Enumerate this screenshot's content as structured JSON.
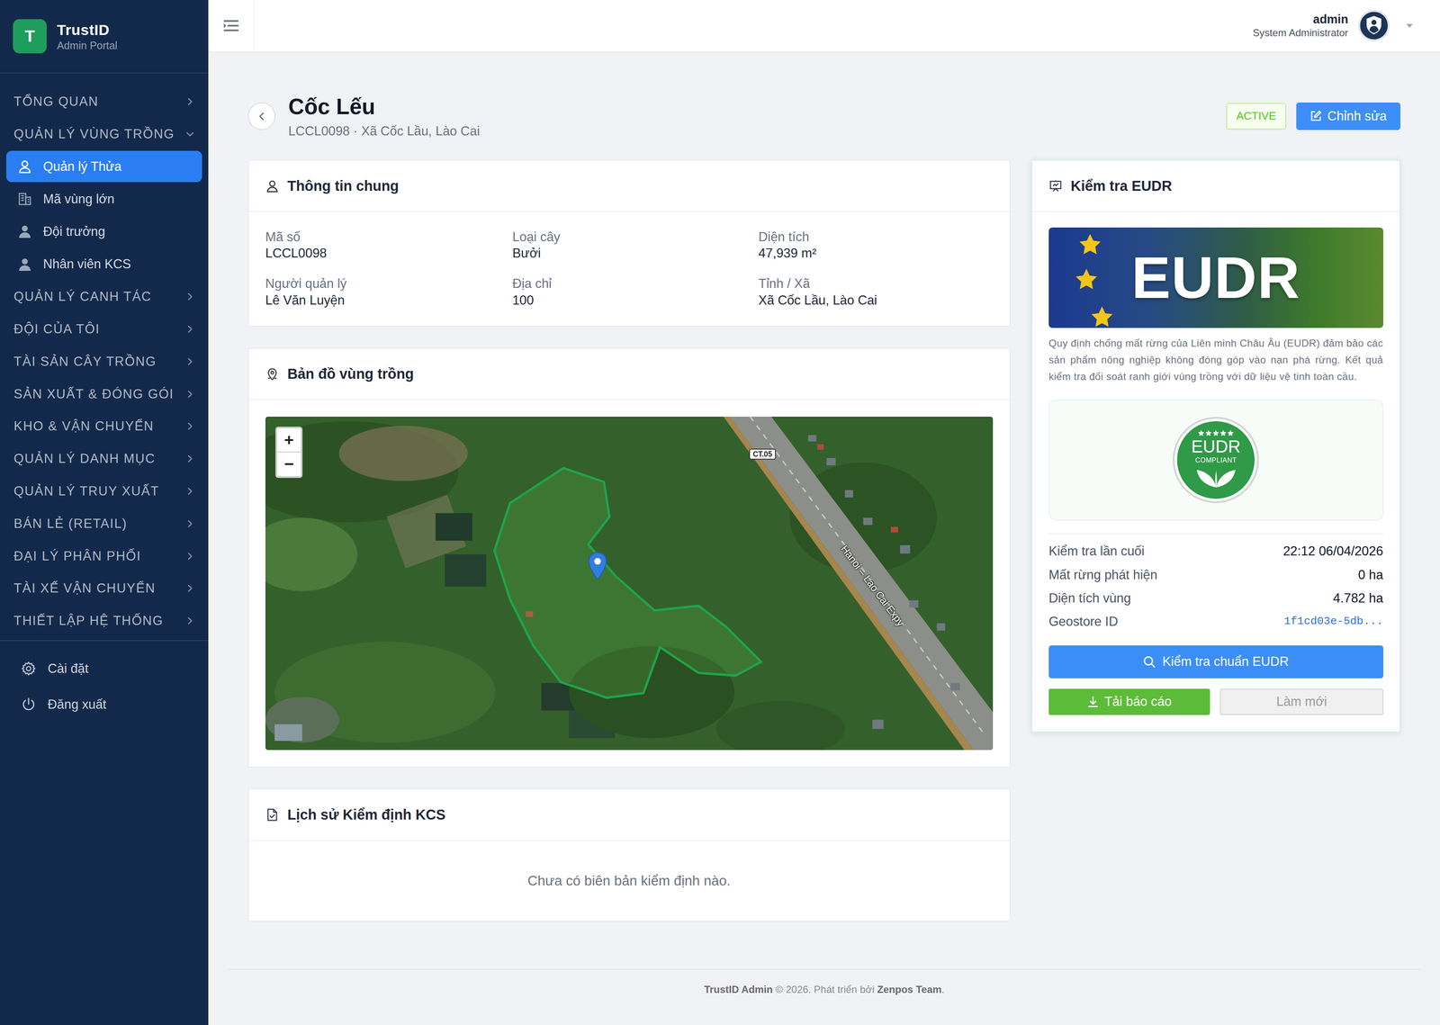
{
  "brand": {
    "logo": "T",
    "name": "TrustID",
    "subtitle": "Admin Portal"
  },
  "sidebar": {
    "items": [
      {
        "label": "TỔNG QUAN",
        "kind": "section",
        "expanded": false,
        "selected": false
      },
      {
        "label": "QUẢN LÝ VÙNG TRỒNG",
        "kind": "section",
        "expanded": true,
        "selected": false
      },
      {
        "label": "Quản lý Thửa",
        "kind": "child",
        "selected": true
      },
      {
        "label": "Mã vùng lớn",
        "kind": "child",
        "selected": false
      },
      {
        "label": "Đội trưởng",
        "kind": "child",
        "selected": false
      },
      {
        "label": "Nhân viên KCS",
        "kind": "child",
        "selected": false
      },
      {
        "label": "QUẢN LÝ CANH TÁC",
        "kind": "section",
        "expanded": false,
        "selected": false
      },
      {
        "label": "ĐỘI CỦA TÔI",
        "kind": "section",
        "expanded": false,
        "selected": false
      },
      {
        "label": "TÀI SẢN CÂY TRỒNG",
        "kind": "section",
        "expanded": false,
        "selected": false
      },
      {
        "label": "SẢN XUẤT & ĐÓNG GÓI",
        "kind": "section",
        "expanded": false,
        "selected": false
      },
      {
        "label": "KHO & VẬN CHUYỂN",
        "kind": "section",
        "expanded": false,
        "selected": false
      },
      {
        "label": "QUẢN LÝ DANH MỤC",
        "kind": "section",
        "expanded": false,
        "selected": false
      },
      {
        "label": "QUẢN LÝ TRUY XUẤT",
        "kind": "section",
        "expanded": false,
        "selected": false
      },
      {
        "label": "BÁN LẺ (RETAIL)",
        "kind": "section",
        "expanded": false,
        "selected": false
      },
      {
        "label": "ĐẠI LÝ PHÂN PHỐI",
        "kind": "section",
        "expanded": false,
        "selected": false
      },
      {
        "label": "TÀI XẾ VẬN CHUYỂN",
        "kind": "section",
        "expanded": false,
        "selected": false
      },
      {
        "label": "THIẾT LẬP HỆ THỐNG",
        "kind": "section",
        "expanded": false,
        "selected": false
      }
    ],
    "footer": [
      {
        "label": "Cài đặt"
      },
      {
        "label": "Đăng xuất"
      }
    ]
  },
  "header": {
    "user": {
      "name": "admin",
      "role": "System Administrator"
    }
  },
  "page": {
    "title": "Cốc Lếu",
    "subtitle": "LCCL0098 · Xã Cốc Lầu, Lào Cai",
    "status": "ACTIVE",
    "edit_button": "Chỉnh sửa"
  },
  "info": {
    "title": "Thông tin chung",
    "fields": [
      {
        "label": "Mã số",
        "value": "LCCL0098"
      },
      {
        "label": "Loại cây",
        "value": "Bưởi"
      },
      {
        "label": "Diện tích",
        "value": "47,939 m²"
      },
      {
        "label": "Người quản lý",
        "value": "Lê Văn Luyện"
      },
      {
        "label": "Địa chỉ",
        "value": "100"
      },
      {
        "label": "Tỉnh / Xã",
        "value": "Xã Cốc Lầu, Lào Cai"
      }
    ]
  },
  "map": {
    "title": "Bản đồ vùng trồng",
    "zoom_in": "+",
    "zoom_out": "−",
    "labels": [
      "CT.05",
      "Hanoi – Lao Cai Expy"
    ]
  },
  "kcs": {
    "title": "Lịch sử Kiểm định KCS",
    "empty": "Chưa có biên bản kiểm định nào."
  },
  "eudr": {
    "title": "Kiểm tra EUDR",
    "banner": "EUDR",
    "description": "Quy định chống mất rừng của Liên minh Châu Âu (EUDR) đảm bảo các sản phẩm nông nghiệp không đóng góp vào nạn phá rừng. Kết quả kiểm tra đối soát ranh giới vùng trồng với dữ liệu vệ tinh toàn cầu.",
    "badge": {
      "title": "EUDR",
      "subtitle": "COMPLIANT"
    },
    "stats": [
      {
        "label": "Kiểm tra lần cuối",
        "value": "22:12 06/04/2026",
        "kind": "text"
      },
      {
        "label": "Mất rừng phát hiện",
        "value": "0 ha",
        "kind": "text"
      },
      {
        "label": "Diện tích vùng",
        "value": "4.782 ha",
        "kind": "text"
      },
      {
        "label": "Geostore ID",
        "value": "1f1cd03e-5db...",
        "kind": "code"
      }
    ],
    "check_button": "Kiểm tra chuẩn EUDR",
    "download_button": "Tải báo cáo",
    "refresh_button": {
      "label": "Làm mới",
      "disabled": true
    }
  },
  "footer": [
    {
      "text": "TrustID Admin",
      "bold": true
    },
    {
      "text": " © 2026. Phát triển bởi ",
      "bold": false
    },
    {
      "text": "Zenpos Team",
      "bold": true
    },
    {
      "text": ".",
      "bold": false
    }
  ]
}
